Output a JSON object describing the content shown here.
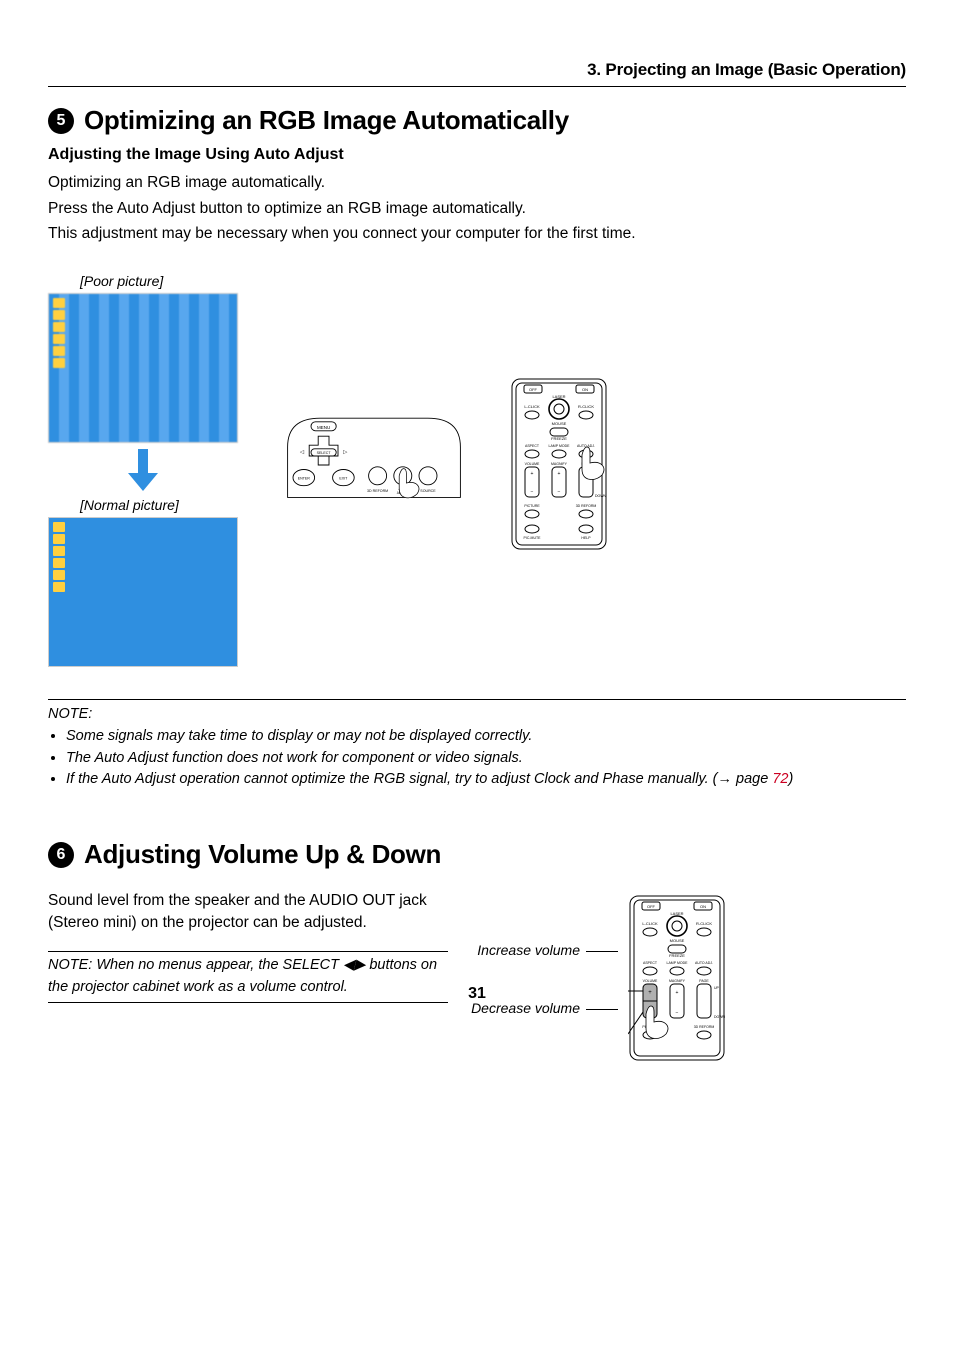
{
  "chapter_header": "3. Projecting an Image (Basic Operation)",
  "section5": {
    "number": "5",
    "title": "Optimizing an RGB Image Automatically",
    "subtitle": "Adjusting the Image Using Auto Adjust",
    "p1": "Optimizing an RGB image automatically.",
    "p2": "Press the Auto Adjust button to optimize an RGB image automatically.",
    "p3": "This adjustment may be necessary when you connect your computer for the first time.",
    "label_poor": "[Poor picture]",
    "label_normal": "[Normal picture]"
  },
  "control_panel": {
    "menu": "MENU",
    "select": "SELECT",
    "enter": "ENTER",
    "exit": "EXIT",
    "reform": "3D REFORM",
    "auto": "AUTO\nADJUST",
    "source": "SOURCE"
  },
  "remote": {
    "off": "OFF",
    "on": "ON",
    "laser": "LASER",
    "lclick": "L-CLICK",
    "rclick": "R-CLICK",
    "mouse": "MOUSE",
    "freeze": "FREEZE",
    "aspect": "ASPECT",
    "lampmode": "LAMP MODE",
    "autoadj": "AUTO ADJ.",
    "volume": "VOLUME",
    "magnify": "MAGNIFY",
    "page": "PAGE",
    "up": "UP",
    "down": "DOWN",
    "picture": "PICTURE",
    "reform": "3D REFORM",
    "picmute": "PIC-MUTE",
    "help": "HELP"
  },
  "note": {
    "label": "NOTE:",
    "b1": "Some signals may take time to display or may not be displayed correctly.",
    "b2": "The Auto Adjust function does not work for component or video signals.",
    "b3a": "If the Auto Adjust operation cannot optimize the RGB signal, try to adjust Clock and Phase manually. (",
    "arrow": "→",
    "b3b": " page ",
    "page_link": "72",
    "b3c": ")"
  },
  "section6": {
    "number": "6",
    "title": "Adjusting Volume Up & Down",
    "p1": "Sound level from the speaker and the AUDIO OUT jack (Stereo mini) on the projector can be adjusted.",
    "note_a": "NOTE: When no menus appear, the SELECT ",
    "note_tri": "◀▶",
    "note_b": " buttons on the projector cabinet work as a volume control.",
    "increase": "Increase volume",
    "decrease": "Decrease volume"
  },
  "page_number": "31"
}
